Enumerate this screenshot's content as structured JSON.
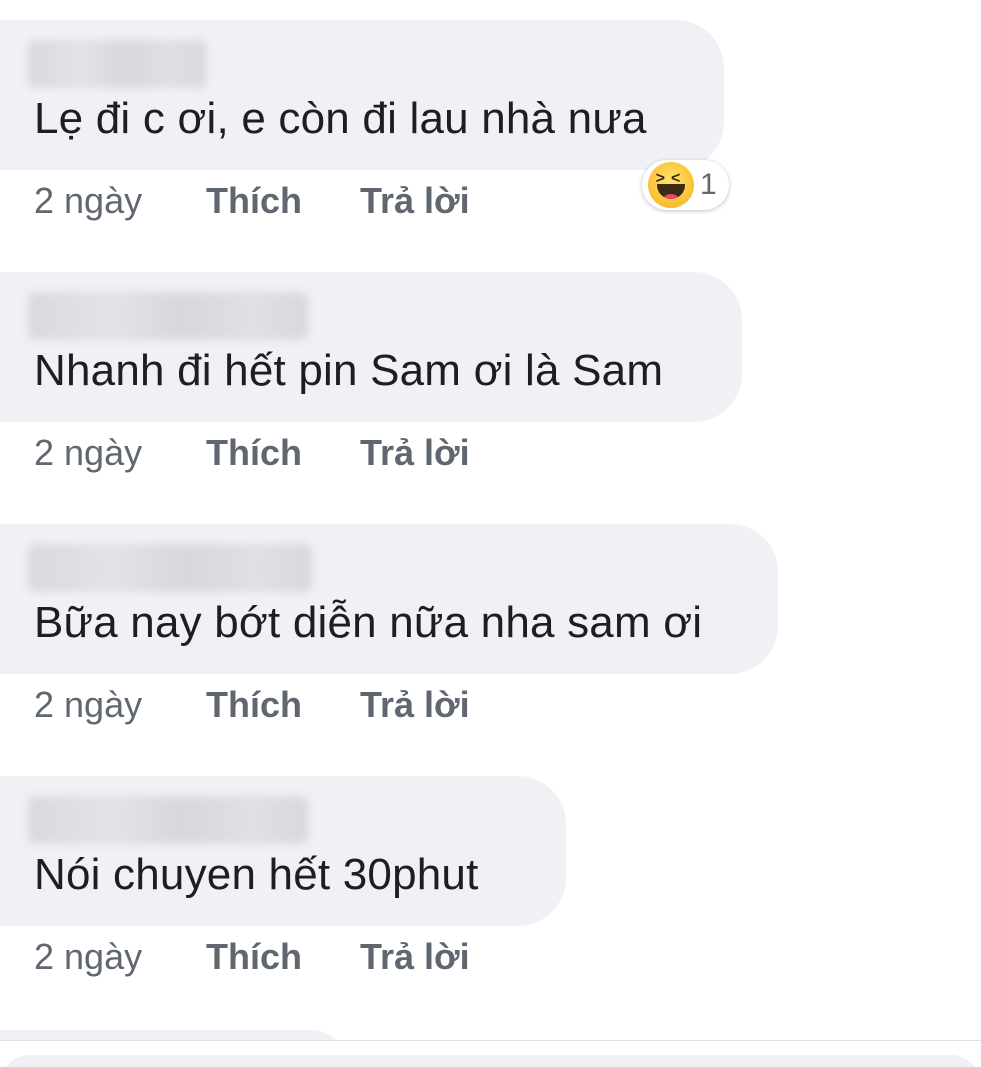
{
  "comments": [
    {
      "text": "Lẹ đi c ơi, e còn đi lau nhà nưa",
      "time": "2 ngày",
      "like_label": "Thích",
      "reply_label": "Trả lời",
      "reaction": {
        "icon": "haha-icon",
        "count": "1"
      }
    },
    {
      "text": "Nhanh đi hết pin Sam ơi là Sam",
      "time": "2 ngày",
      "like_label": "Thích",
      "reply_label": "Trả lời"
    },
    {
      "text": "Bữa nay bớt diễn nữa nha sam ơi",
      "time": "2 ngày",
      "like_label": "Thích",
      "reply_label": "Trả lời"
    },
    {
      "text": "Nói chuyen hết 30phut",
      "time": "2 ngày",
      "like_label": "Thích",
      "reply_label": "Trả lời"
    }
  ],
  "colors": {
    "bubble": "#f0f1f4",
    "text": "#1c1e21",
    "meta": "#606770",
    "haha": "#fcc43a"
  }
}
